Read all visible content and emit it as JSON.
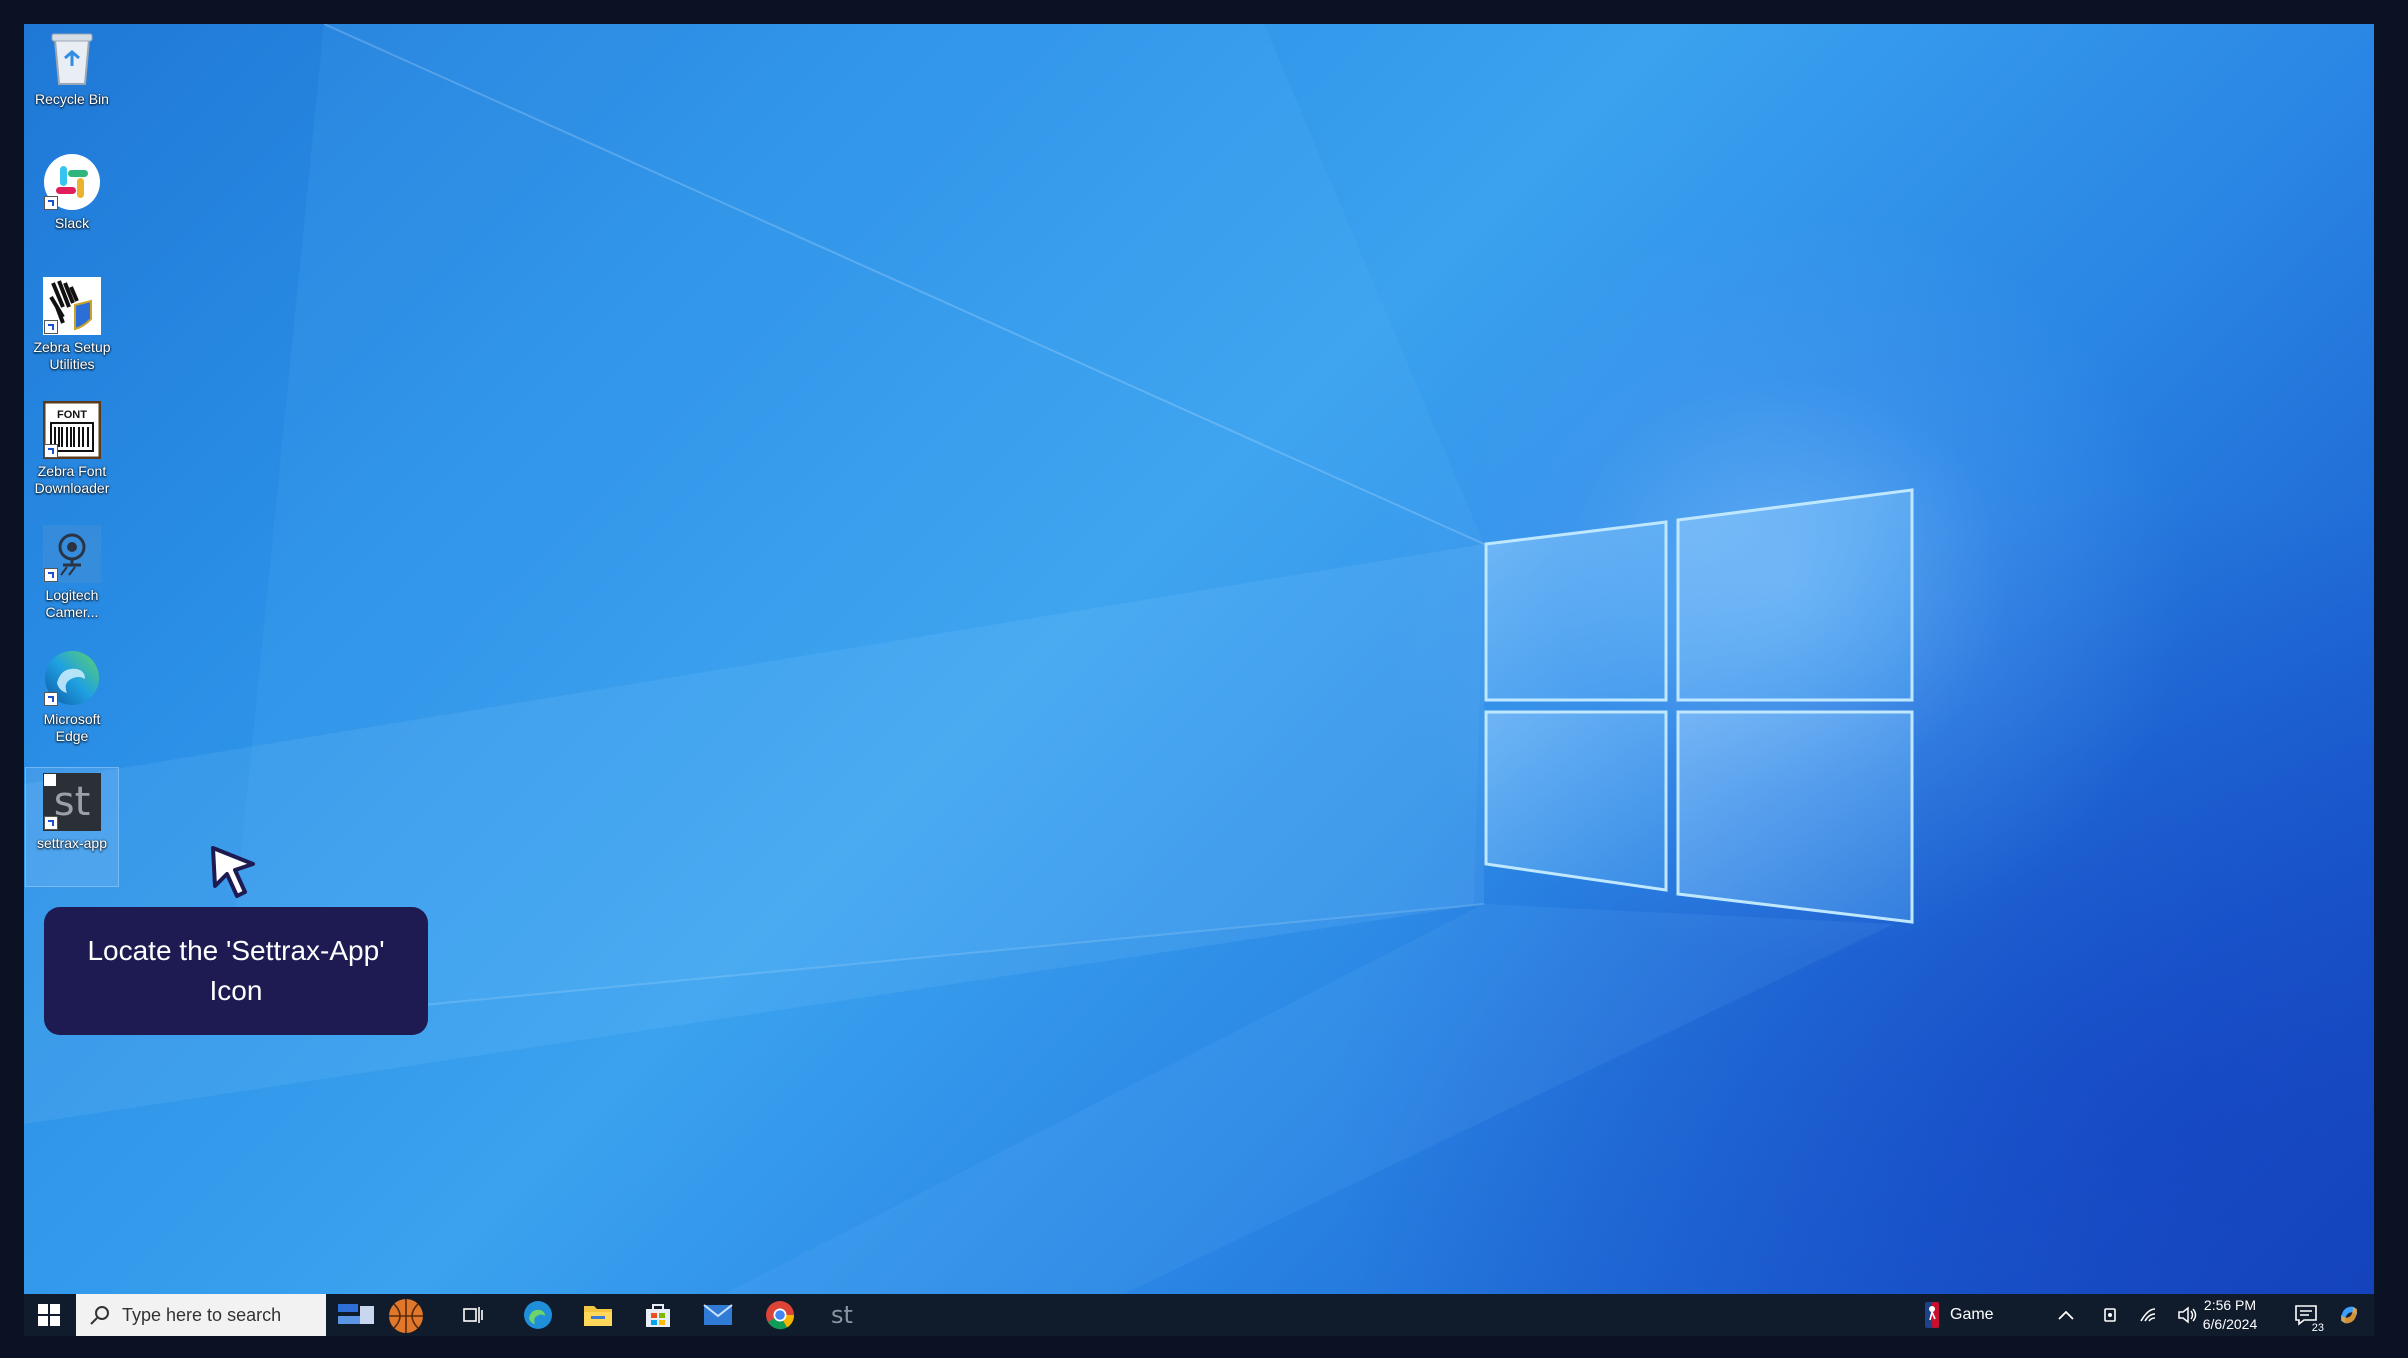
{
  "desktop": {
    "icons": [
      {
        "label": "Recycle Bin",
        "icon": "recycle-bin-icon"
      },
      {
        "label": "Slack",
        "icon": "slack-icon"
      },
      {
        "label": "Zebra Setup\nUtilities",
        "icon": "zebra-setup-icon"
      },
      {
        "label": "Zebra Font\nDownloader",
        "icon": "zebra-font-icon"
      },
      {
        "label": "Logitech\nCamer...",
        "icon": "logitech-camera-icon"
      },
      {
        "label": "Microsoft\nEdge",
        "icon": "edge-icon"
      },
      {
        "label": "settrax-app",
        "icon": "settrax-app-icon"
      }
    ],
    "settrax_glyph": "st",
    "font_badge": "FONT"
  },
  "tooltip": {
    "text": "Locate the 'Settrax-App' Icon",
    "background": "#1d1b52"
  },
  "taskbar": {
    "search_placeholder": "Type here to search",
    "apps": [
      "task-view-icon",
      "edge-icon",
      "file-explorer-icon",
      "store-icon",
      "mail-icon",
      "chrome-icon",
      "settrax-app-icon"
    ],
    "settrax_glyph": "st",
    "widget_label": "Game",
    "time": "2:56 PM",
    "date": "6/6/2024",
    "notification_count": "23"
  }
}
